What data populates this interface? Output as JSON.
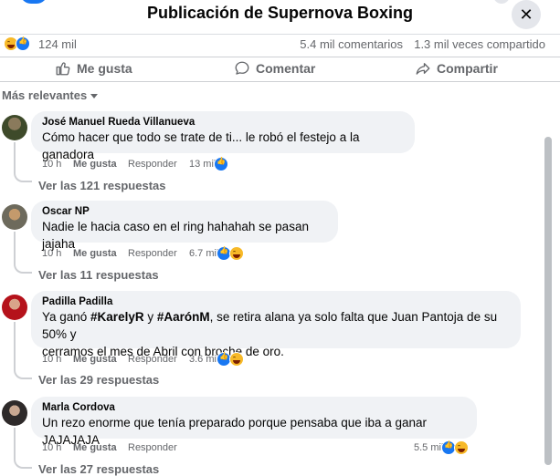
{
  "header": {
    "title": "Publicación de Supernova Boxing",
    "close_icon": "close-icon"
  },
  "stats": {
    "reactions_count": "124 mil",
    "comments": "5.4 mil comentarios",
    "shares": "1.3 mil veces compartido",
    "reaction_icons": [
      "haha-icon",
      "like-icon"
    ]
  },
  "actions": {
    "like": "Me gusta",
    "comment": "Comentar",
    "share": "Compartir"
  },
  "sort": {
    "label": "Más relevantes"
  },
  "comments": [
    {
      "author": "José Manuel Rueda Villanueva",
      "text": "Cómo hacer que todo se trate de ti... le robó el festejo a la ganadora",
      "time": "10 h",
      "like": "Me gusta",
      "reply": "Responder",
      "reaction_count": "13 mil",
      "reactions": [
        "like-icon"
      ],
      "replies": "Ver las 121 respuestas"
    },
    {
      "author": "Oscar NP",
      "text": "Nadie le hacia caso en el ring hahahah se pasan jajaha",
      "time": "10 h",
      "like": "Me gusta",
      "reply": "Responder",
      "reaction_count": "6.7 mil",
      "reactions": [
        "like-icon",
        "haha-icon"
      ],
      "replies": "Ver las 11 respuestas"
    },
    {
      "author": "Padilla Padilla",
      "text_line1_prefix": "Ya ganó ",
      "tag1": "#KarelyR",
      "text_line1_mid": " y ",
      "tag2": "#AarónM",
      "text_line1_suffix": ", se retira alana ya solo falta que Juan Pantoja de su 50% y",
      "text_line2": "cerramos el mes de Abril con broche de oro.",
      "time": "10 h",
      "like": "Me gusta",
      "reply": "Responder",
      "reaction_count": "3.6 mil",
      "reactions": [
        "like-icon",
        "haha-icon"
      ],
      "replies": "Ver las 29 respuestas"
    },
    {
      "author": "Marla Cordova",
      "text": "Un rezo enorme que tenía preparado porque pensaba que iba a ganar JAJAJAJA",
      "time": "10 h",
      "like": "Me gusta",
      "reply": "Responder",
      "reaction_count": "5.5 mil",
      "reactions": [
        "like-icon",
        "haha-icon"
      ],
      "replies": "Ver las 27 respuestas"
    }
  ],
  "colors": {
    "accent": "#1877f2",
    "secondary_text": "#65676b",
    "bubble": "#f0f2f5"
  }
}
